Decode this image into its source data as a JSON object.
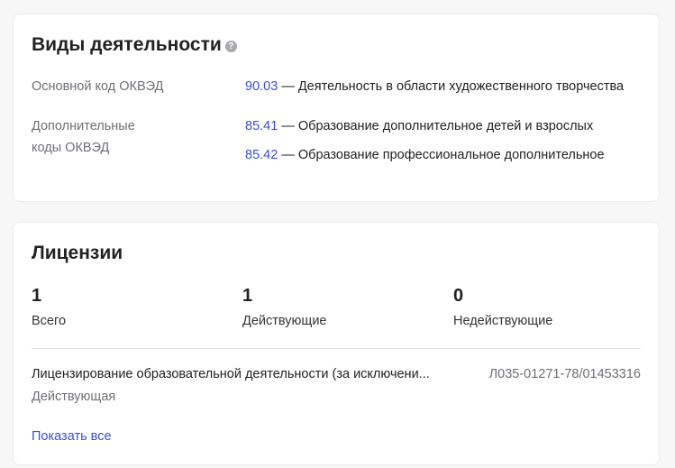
{
  "activities": {
    "title": "Виды деятельности",
    "help_icon": "question-mark-icon",
    "main_label": "Основной код ОКВЭД",
    "main": {
      "code": "90.03",
      "text": " — Деятельность в области художественного творчества"
    },
    "additional_label_line1": "Дополнительные",
    "additional_label_line2": "коды ОКВЭД",
    "additional": [
      {
        "code": "85.41",
        "text": " — Образование дополнительное детей и взрослых"
      },
      {
        "code": "85.42",
        "text": " — Образование профессиональное дополнительное"
      }
    ]
  },
  "licenses": {
    "title": "Лицензии",
    "stats": [
      {
        "value": "1",
        "label": "Всего"
      },
      {
        "value": "1",
        "label": "Действующие"
      },
      {
        "value": "0",
        "label": "Недействующие"
      }
    ],
    "item": {
      "name": "Лицензирование образовательной деятельности (за исключени...",
      "number": "Л035-01271-78/01453316",
      "status": "Действующая"
    },
    "show_all": "Показать все"
  },
  "colors": {
    "link": "#3c4fd4",
    "muted": "#6f6f76",
    "background": "#f7f7f8"
  }
}
